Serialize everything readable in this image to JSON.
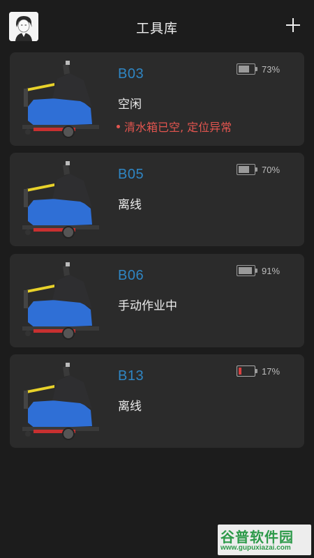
{
  "header": {
    "title": "工具库",
    "avatar_icon": "avatar-portrait",
    "add_icon": "plus-icon"
  },
  "devices": [
    {
      "code": "B03",
      "status": "空闲",
      "alert": "清水箱已空, 定位异常",
      "battery_pct_label": "73%",
      "battery_level": 0.73,
      "battery_color": "#9a9a9a"
    },
    {
      "code": "B05",
      "status": "离线",
      "alert": "",
      "battery_pct_label": "70%",
      "battery_level": 0.7,
      "battery_color": "#9a9a9a"
    },
    {
      "code": "B06",
      "status": "手动作业中",
      "alert": "",
      "battery_pct_label": "91%",
      "battery_level": 0.91,
      "battery_color": "#9a9a9a"
    },
    {
      "code": "B13",
      "status": "离线",
      "alert": "",
      "battery_pct_label": "17%",
      "battery_level": 0.17,
      "battery_color": "#d94040"
    }
  ],
  "colors": {
    "background": "#1c1c1c",
    "card": "#2b2b2b",
    "accent_blue": "#2f86c4",
    "alert_red": "#e3554f"
  },
  "watermark": {
    "main": "谷普软件园",
    "url": "www.gupuxiazai.com"
  }
}
